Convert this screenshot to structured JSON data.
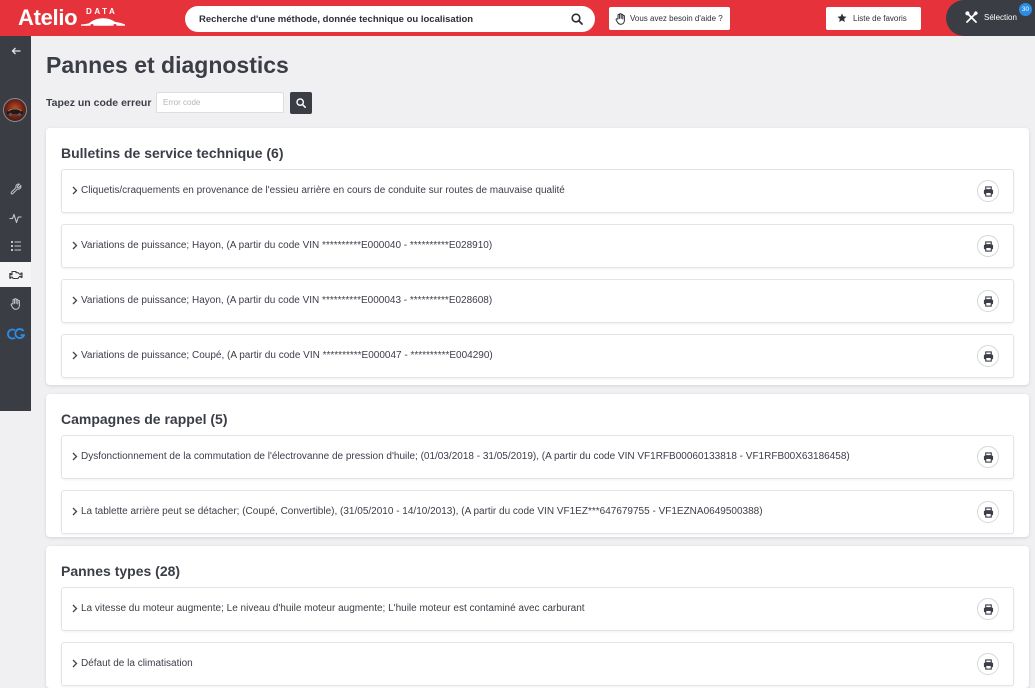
{
  "colors": {
    "header_red": "#e6333b",
    "sidebar_dark": "#3b3d45",
    "badge_blue": "#2a8ee8",
    "page_background": "#f0f0f2"
  },
  "header": {
    "logo": {
      "main": "Atelio",
      "sub": "DATA"
    },
    "search": {
      "placeholder": "Recherche d'une méthode, donnée technique ou localisation",
      "icon": "search-icon"
    },
    "help_button": {
      "label": "Vous avez besoin d'aide ?",
      "icon": "hand-icon"
    },
    "favorites_button": {
      "label": "Liste de favoris",
      "icon": "star-icon"
    },
    "selection": {
      "label": "Sélection",
      "count": "30",
      "icon": "tools-icon"
    }
  },
  "sidebar": {
    "items": [
      {
        "icon": "back-arrow-icon",
        "active": false
      },
      {
        "icon": "vehicle-avatar",
        "active": false
      },
      {
        "icon": "wrench-icon",
        "active": false
      },
      {
        "icon": "pulse-icon",
        "active": false
      },
      {
        "icon": "checklist-icon",
        "active": false
      },
      {
        "icon": "engine-icon",
        "active": true
      },
      {
        "icon": "hand-icon",
        "active": false
      },
      {
        "icon": "cg-logo-icon",
        "active": false
      }
    ]
  },
  "page": {
    "title": "Pannes et diagnostics",
    "error_code": {
      "label": "Tapez un code erreur",
      "placeholder": "Error code",
      "button_icon": "search-icon"
    }
  },
  "row_icons": {
    "expand": "chevron-right-icon",
    "print": "printer-icon"
  },
  "sections": [
    {
      "title": "Bulletins de service technique (6)",
      "items": [
        {
          "label": "Cliquetis/craquements en provenance de l'essieu arrière en cours de conduite sur routes de mauvaise qualité"
        },
        {
          "label": "Variations de puissance; Hayon, (A partir du code VIN **********E000040 - **********E028910)"
        },
        {
          "label": "Variations de puissance; Hayon, (A partir du code VIN **********E000043 - **********E028608)"
        },
        {
          "label": "Variations de puissance; Coupé, (A partir du code VIN **********E000047 - **********E004290)"
        }
      ]
    },
    {
      "title": "Campagnes de rappel (5)",
      "items": [
        {
          "label": "Dysfonctionnement de la commutation de l'électrovanne de pression d'huile; (01/03/2018 - 31/05/2019), (A partir du code VIN VF1RFB00060133818 - VF1RFB00X63186458)"
        },
        {
          "label": "La tablette arrière peut se détacher; (Coupé, Convertible), (31/05/2010 - 14/10/2013), (A partir du code VIN VF1EZ***647679755 - VF1EZNA0649500388)"
        }
      ]
    },
    {
      "title": "Pannes types (28)",
      "items": [
        {
          "label": "La vitesse du moteur augmente; Le niveau d'huile moteur augmente; L'huile moteur est contaminé avec carburant"
        },
        {
          "label": "Défaut de la climatisation"
        }
      ]
    }
  ]
}
